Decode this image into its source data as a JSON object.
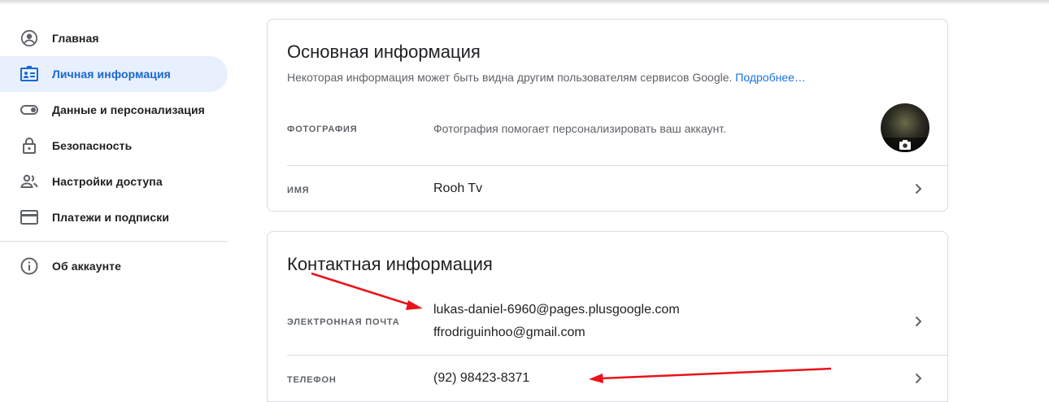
{
  "sidebar": {
    "items": [
      {
        "label": "Главная",
        "icon": "account-circle-icon"
      },
      {
        "label": "Личная информация",
        "icon": "id-card-icon",
        "active": true
      },
      {
        "label": "Данные и персонализация",
        "icon": "toggle-icon"
      },
      {
        "label": "Безопасность",
        "icon": "lock-icon"
      },
      {
        "label": "Настройки доступа",
        "icon": "people-icon"
      },
      {
        "label": "Платежи и подписки",
        "icon": "credit-card-icon"
      }
    ],
    "about": {
      "label": "Об аккаунте",
      "icon": "info-icon"
    }
  },
  "basic_info": {
    "title": "Основная информация",
    "subtitle": "Некоторая информация может быть видна другим пользователям сервисов Google.",
    "more_link": "Подробнее…",
    "photo_label": "ФОТОГРАФИЯ",
    "photo_text": "Фотография помогает персонализировать ваш аккаунт.",
    "name_label": "ИМЯ",
    "name_value": "Rooh Tv"
  },
  "contact_info": {
    "title": "Контактная информация",
    "email_label": "ЭЛЕКТРОННАЯ ПОЧТА",
    "emails": [
      "lukas-daniel-6960@pages.plusgoogle.com",
      "ffrodriguinhoo@gmail.com"
    ],
    "phone_label": "ТЕЛЕФОН",
    "phone_value": "(92) 98423-8371"
  },
  "colors": {
    "accent": "#1a73e8",
    "active_bg": "#e8f0fe",
    "annotation": "#e8141b"
  }
}
